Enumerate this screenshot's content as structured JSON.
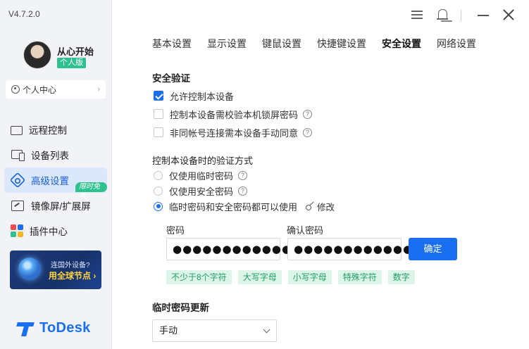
{
  "app": {
    "version": "V4.7.2.0",
    "logo_text": "ToDesk"
  },
  "user": {
    "name": "从心开始",
    "edition": "个人版",
    "personal_center": "个人中心"
  },
  "sidebar": {
    "items": [
      {
        "label": "远程控制",
        "icon": "monitor-icon"
      },
      {
        "label": "设备列表",
        "icon": "devices-icon"
      },
      {
        "label": "高级设置",
        "icon": "settings-icon",
        "active": true
      },
      {
        "label": "镜像屏/扩展屏",
        "icon": "mirror-screen-icon",
        "badge": "限时免费"
      },
      {
        "label": "插件中心",
        "icon": "plugins-icon"
      }
    ],
    "promo": {
      "line1": "连国外设备?",
      "line2": "用全球节点 ›"
    }
  },
  "tabs": [
    {
      "label": "基本设置"
    },
    {
      "label": "显示设置"
    },
    {
      "label": "键鼠设置"
    },
    {
      "label": "快捷键设置"
    },
    {
      "label": "安全设置",
      "active": true
    },
    {
      "label": "网络设置"
    }
  ],
  "security": {
    "title": "安全验证",
    "options": [
      {
        "label": "允许控制本设备",
        "checked": true
      },
      {
        "label": "控制本设备需校验本机锁屏密码",
        "checked": false,
        "help": "?"
      },
      {
        "label": "非同帐号连接需本设备手动同意",
        "checked": false,
        "help": "?"
      }
    ]
  },
  "verification": {
    "title": "控制本设备时的验证方式",
    "options": [
      {
        "label": "仅使用临时密码",
        "selected": false,
        "help": "?"
      },
      {
        "label": "仅使用安全密码",
        "selected": false,
        "help": "?"
      },
      {
        "label": "临时密码和安全密码都可以使用",
        "selected": true,
        "modify": "修改"
      }
    ]
  },
  "password": {
    "label": "密码",
    "value": "●●●●●●●●●●●●",
    "confirm_label": "确认密码",
    "confirm_value": "●●●●●●●●●●●●",
    "confirm_button": "确定",
    "rules": [
      "不少于8个字符",
      "大写字母",
      "小写字母",
      "特殊字符",
      "数字"
    ]
  },
  "temp_password": {
    "title": "临时密码更新",
    "selected": "手动"
  },
  "colors": {
    "accent": "#1a6ff0",
    "success": "#2fc18d",
    "rule_bg": "#ddf5e9",
    "rule_text": "#1f9e63"
  }
}
